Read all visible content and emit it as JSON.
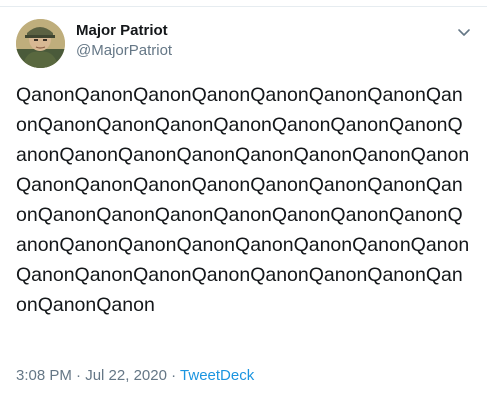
{
  "tweet": {
    "author_name": "Major Patriot",
    "author_handle": "@MajorPatriot",
    "text": "QanonQanonQanonQanonQanonQanonQanonQanonQanonQanonQanonQanonQanonQanonQanonQanonQanonQanonQanonQanonQanonQanonQanonQanonQanonQanonQanonQanonQanonQanonQanonQanonQanonQanonQanonQanonQanonQanonQanonQanonQanonQanonQanonQanonQanonQanonQanonQanonQanonQanonQanonQanonQanonQanonQanonQanon",
    "time": "3:08 PM",
    "separator": "·",
    "date": "Jul 22, 2020",
    "source": "TweetDeck",
    "menu_icon": "chevron-down-icon",
    "avatar_icon": "avatar"
  },
  "colors": {
    "text": "#14171a",
    "secondary": "#657786",
    "link": "#1b95e0",
    "divider": "#e6ecf0"
  }
}
